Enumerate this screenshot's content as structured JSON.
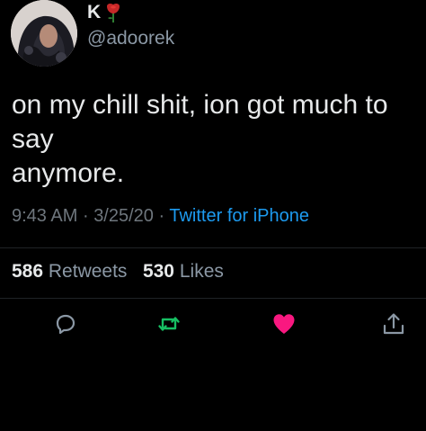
{
  "user": {
    "display_name": "K",
    "handle": "@adoorek",
    "name_emoji_icon": "rose-icon"
  },
  "tweet": {
    "text": "on my chill shit, ion got much to say\nanymore."
  },
  "meta": {
    "time": "9:43 AM",
    "date": "3/25/20",
    "separator": "·",
    "source": "Twitter for iPhone"
  },
  "stats": {
    "retweets_count": "586",
    "retweets_label": "Retweets",
    "likes_count": "530",
    "likes_label": "Likes"
  },
  "actions": [
    {
      "name": "reply",
      "icon": "reply-icon",
      "color": "#8b98a5"
    },
    {
      "name": "retweet",
      "icon": "retweet-icon",
      "color": "#17bf63"
    },
    {
      "name": "like",
      "icon": "heart-icon",
      "color": "#f91880"
    },
    {
      "name": "share",
      "icon": "share-icon",
      "color": "#8b98a5"
    }
  ],
  "colors": {
    "background": "#000000",
    "text": "#e7e9ea",
    "secondary_text": "#8b98a5",
    "link": "#1d9bf0",
    "retweet_active": "#17bf63",
    "like_active": "#f91880"
  }
}
